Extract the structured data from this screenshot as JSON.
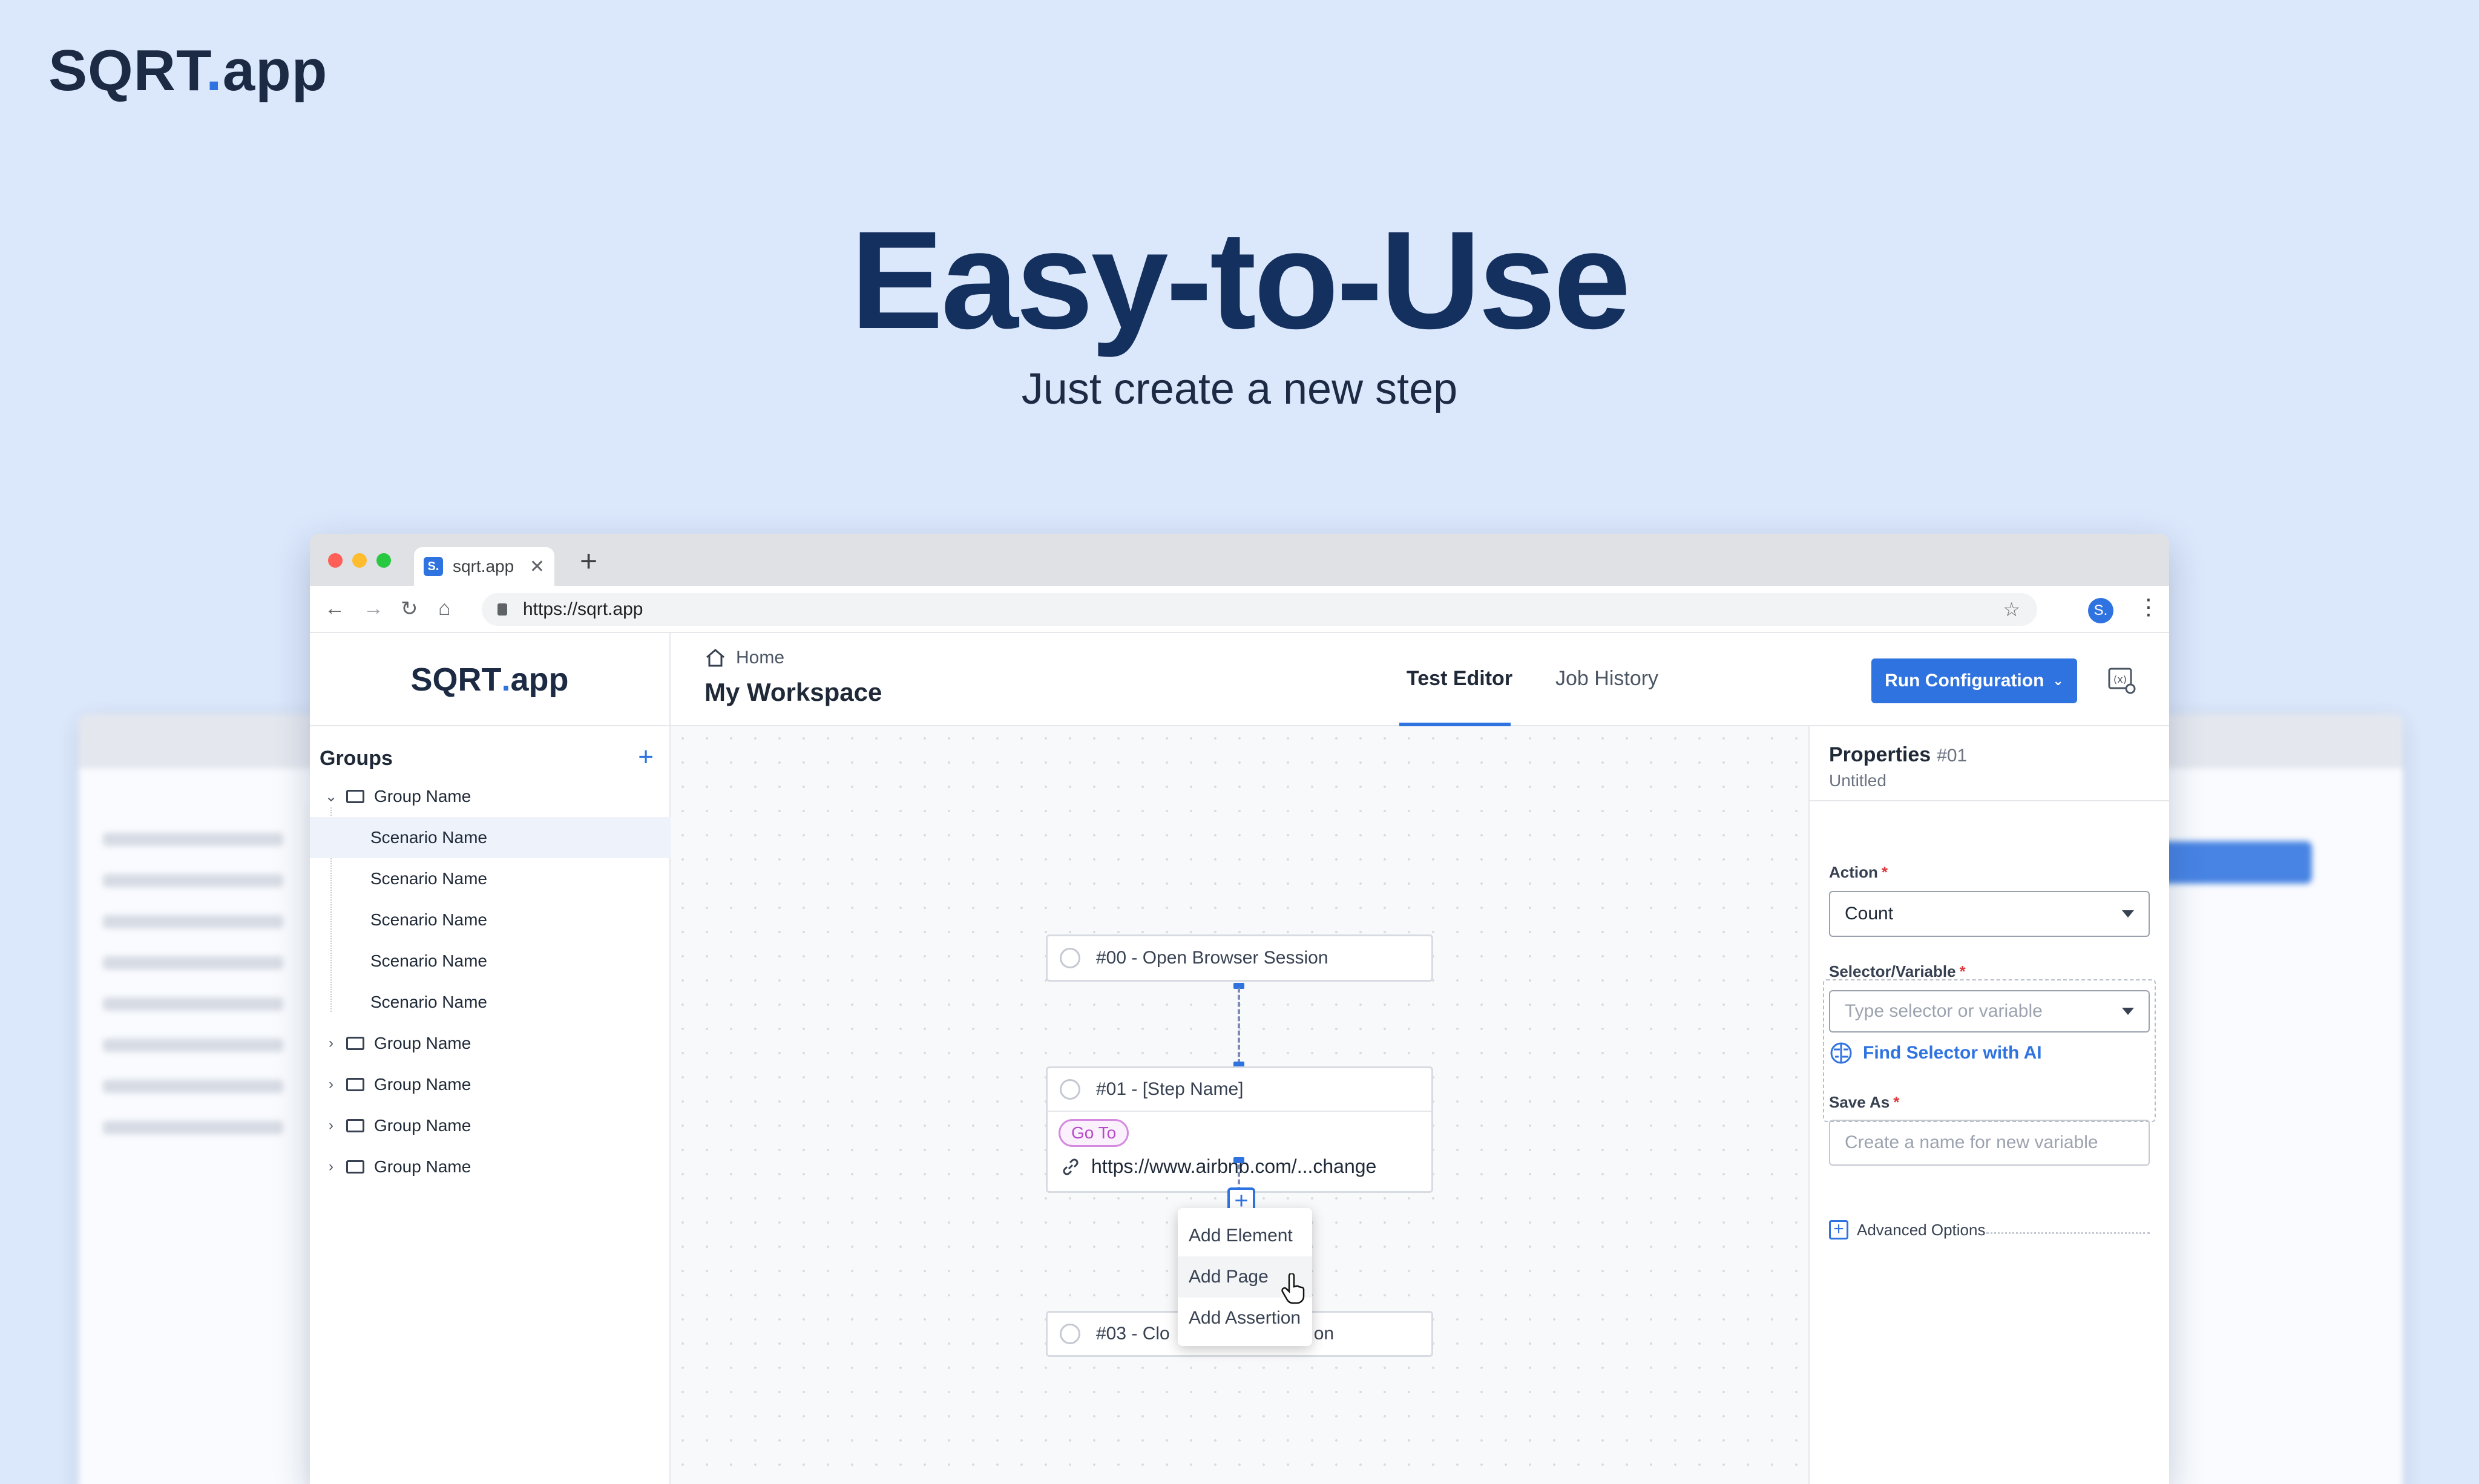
{
  "brand": {
    "name_main": "SQRT",
    "name_dot": ".",
    "name_tail": "app"
  },
  "hero": {
    "title": "Easy-to-Use",
    "subtitle": "Just create a new step"
  },
  "browser": {
    "tab_favicon": "S.",
    "tab_title": "sqrt.app",
    "url": "https://sqrt.app",
    "profile_initial": "S."
  },
  "app": {
    "logo_main": "SQRT",
    "logo_dot": ".",
    "logo_tail": "app",
    "breadcrumb_home": "Home",
    "workspace_title": "My Workspace",
    "tabs": [
      {
        "label": "Test Editor",
        "active": true
      },
      {
        "label": "Job History",
        "active": false
      }
    ],
    "run_button": "Run Configuration"
  },
  "sidebar": {
    "title": "Groups",
    "groups": [
      {
        "label": "Group Name",
        "expanded": true,
        "scenarios": [
          "Scenario Name",
          "Scenario Name",
          "Scenario Name",
          "Scenario Name",
          "Scenario Name"
        ]
      },
      {
        "label": "Group Name",
        "expanded": false
      },
      {
        "label": "Group Name",
        "expanded": false
      },
      {
        "label": "Group Name",
        "expanded": false
      },
      {
        "label": "Group Name",
        "expanded": false
      }
    ]
  },
  "canvas": {
    "nodes": [
      {
        "label": "#00 - Open Browser Session"
      },
      {
        "label": "#01 - [Step Name]",
        "action_badge": "Go To",
        "url": "https://www.airbnb.com/...change"
      },
      {
        "label_start": "#03 - Clo",
        "label_end": "on"
      }
    ],
    "add_menu": [
      "Add Element",
      "Add Page",
      "Add Assertion"
    ]
  },
  "properties": {
    "title": "Properties",
    "step_id": "#01",
    "step_name": "Untitled",
    "action_label": "Action",
    "action_value": "Count",
    "selector_label": "Selector/Variable",
    "selector_placeholder": "Type selector or variable",
    "find_ai": "Find Selector with AI",
    "save_as_label": "Save As",
    "save_as_placeholder": "Create a name for new variable",
    "advanced": "Advanced Options"
  },
  "colors": {
    "accent": "#2f73e0",
    "background": "#dbe7fb",
    "heading": "#14305e",
    "badge": "#b649c9"
  }
}
